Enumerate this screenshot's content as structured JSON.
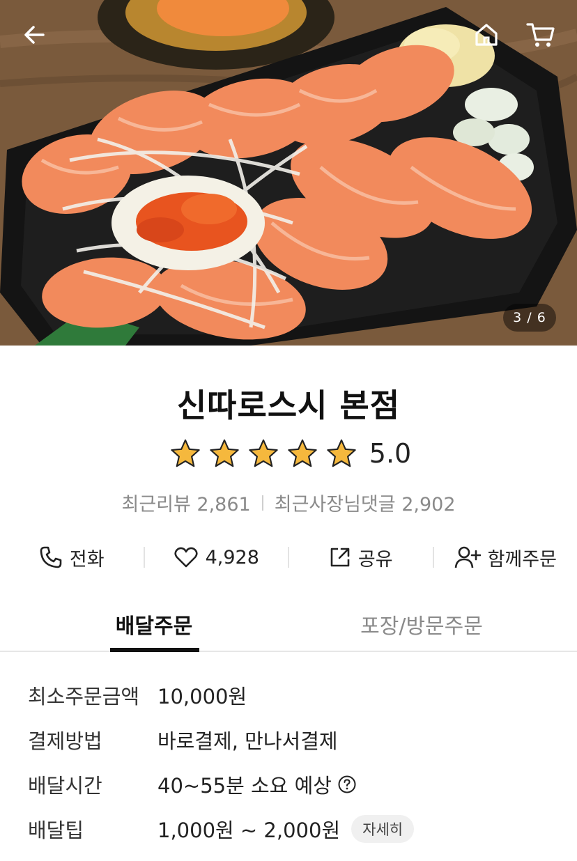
{
  "hero": {
    "image_counter": "3 / 6",
    "icons": {
      "back": "arrow-left-icon",
      "home": "home-icon",
      "cart": "cart-icon"
    }
  },
  "store": {
    "name": "신따로스시 본점",
    "rating": 5.0,
    "rating_text": "5.0",
    "stars": 5,
    "recent_reviews": "최근리뷰 2,861",
    "recent_owner_replies": "최근사장님댓글 2,902"
  },
  "actions": [
    {
      "label": "전화",
      "icon": "phone-icon"
    },
    {
      "label": "4,928",
      "icon": "heart-icon"
    },
    {
      "label": "공유",
      "icon": "share-icon"
    },
    {
      "label": "함께주문",
      "icon": "add-person-icon"
    }
  ],
  "tabs": [
    {
      "label": "배달주문",
      "active": true
    },
    {
      "label": "포장/방문주문",
      "active": false
    }
  ],
  "info": {
    "min_order": {
      "label": "최소주문금액",
      "value": "10,000원"
    },
    "payment": {
      "label": "결제방법",
      "value": "바로결제, 만나서결제"
    },
    "delivery_time": {
      "label": "배달시간",
      "value": "40~55분 소요 예상"
    },
    "delivery_tip": {
      "label": "배달팁",
      "value": "1,000원 ~ 2,000원",
      "detail_button": "자세히"
    }
  },
  "colors": {
    "star": "#F5B83D",
    "active_tab": "#111111",
    "muted_text": "#8A8A8A"
  }
}
